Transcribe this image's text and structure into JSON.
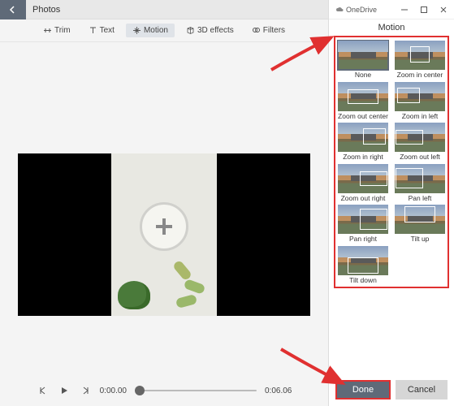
{
  "app": {
    "title": "Photos"
  },
  "toolbar": {
    "trim": "Trim",
    "text": "Text",
    "motion": "Motion",
    "effects3d": "3D effects",
    "filters": "Filters"
  },
  "player": {
    "current_time": "0:00.00",
    "total_time": "0:06.06"
  },
  "panel": {
    "onedrive": "OneDrive",
    "title": "Motion",
    "tiles": [
      {
        "id": "none",
        "label": "None",
        "selected": true
      },
      {
        "id": "zoom-in-center",
        "label": "Zoom in center"
      },
      {
        "id": "zoom-out-center",
        "label": "Zoom out center"
      },
      {
        "id": "zoom-in-left",
        "label": "Zoom in left"
      },
      {
        "id": "zoom-in-right",
        "label": "Zoom in right"
      },
      {
        "id": "zoom-out-left",
        "label": "Zoom out left"
      },
      {
        "id": "zoom-out-right",
        "label": "Zoom out right"
      },
      {
        "id": "pan-left",
        "label": "Pan left"
      },
      {
        "id": "pan-right",
        "label": "Pan right"
      },
      {
        "id": "tilt-up",
        "label": "Tilt up"
      },
      {
        "id": "tilt-down",
        "label": "Tilt down"
      }
    ],
    "done": "Done",
    "cancel": "Cancel"
  }
}
